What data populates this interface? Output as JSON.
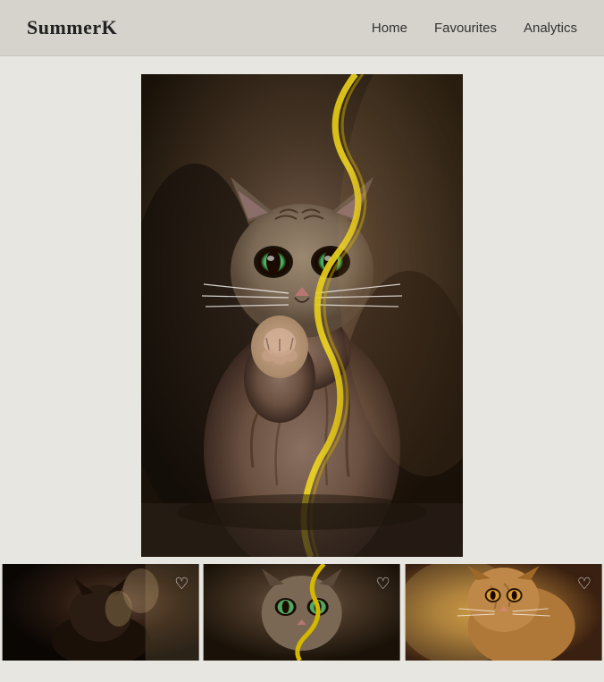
{
  "header": {
    "logo": "SummerK",
    "nav": {
      "home": "Home",
      "favourites": "Favourites",
      "analytics": "Analytics"
    }
  },
  "main": {
    "featured_alt": "Cat playing with yellow ribbon",
    "thumbnails": [
      {
        "alt": "Dark cat portrait",
        "heart": "♡"
      },
      {
        "alt": "Cat with ribbon closeup",
        "heart": "♡"
      },
      {
        "alt": "Orange cat portrait",
        "heart": "♡"
      }
    ]
  }
}
